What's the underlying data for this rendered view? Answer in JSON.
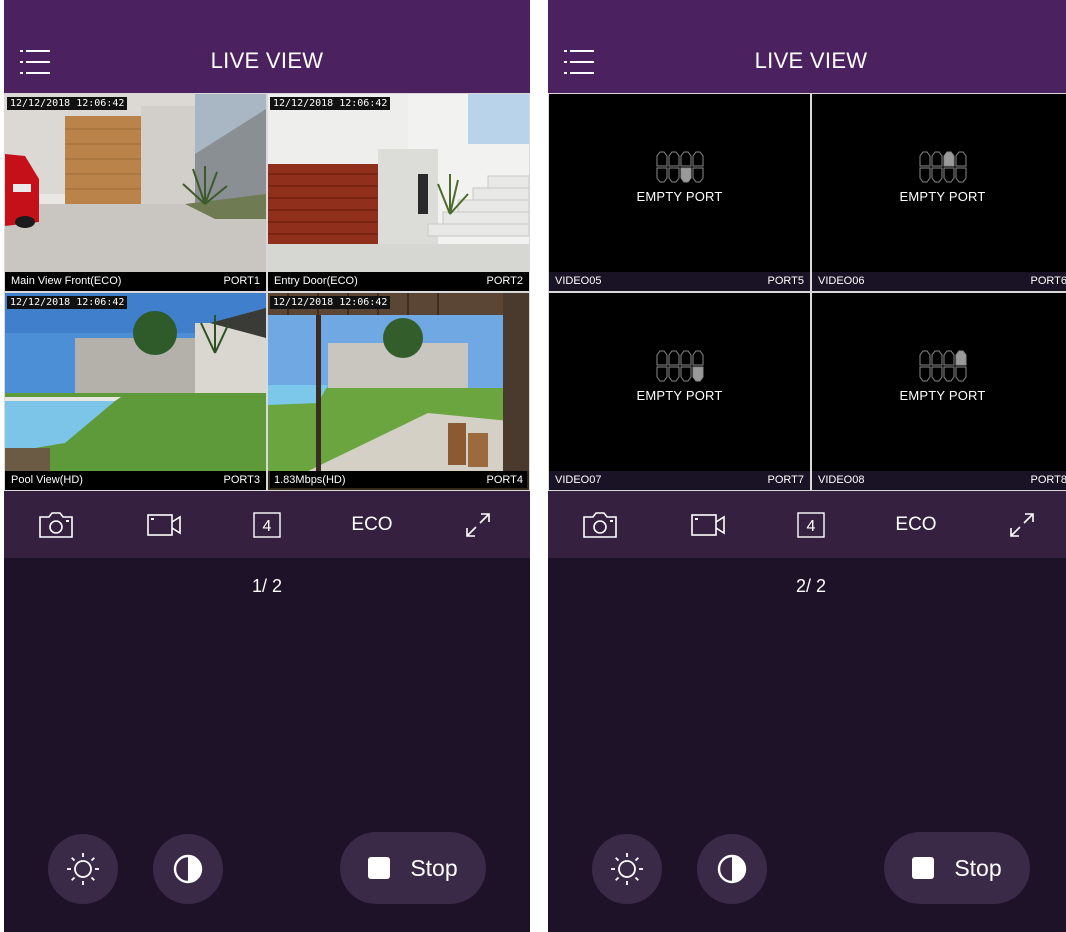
{
  "screens": [
    {
      "title": "LIVE VIEW",
      "page_indicator": "1/ 2",
      "toolbar": {
        "snapshot_icon": "camera-icon",
        "record_icon": "video-camera-icon",
        "layout_label": "4",
        "quality_label": "ECO",
        "fullscreen_icon": "expand-icon"
      },
      "controls": {
        "brightness_icon": "sun-icon",
        "contrast_icon": "contrast-icon",
        "stop_label": "Stop"
      },
      "cells": [
        {
          "timestamp": "12/12/2018 12:06:42",
          "name": "Main View Front(ECO)",
          "port": "PORT1"
        },
        {
          "timestamp": "12/12/2018 12:06:42",
          "name": "Entry Door(ECO)",
          "port": "PORT2"
        },
        {
          "timestamp": "12/12/2018 12:06:42",
          "name": "Pool View(HD)",
          "port": "PORT3"
        },
        {
          "timestamp": "12/12/2018 12:06:42",
          "name": "1.83Mbps(HD)",
          "port": "PORT4",
          "selected": true
        }
      ]
    },
    {
      "title": "LIVE VIEW",
      "page_indicator": "2/ 2",
      "toolbar": {
        "snapshot_icon": "camera-icon",
        "record_icon": "video-camera-icon",
        "layout_label": "4",
        "quality_label": "ECO",
        "fullscreen_icon": "expand-icon"
      },
      "controls": {
        "brightness_icon": "sun-icon",
        "contrast_icon": "contrast-icon",
        "stop_label": "Stop"
      },
      "cells": [
        {
          "status": "EMPTY PORT",
          "name": "VIDEO05",
          "port": "PORT5",
          "active_port_slot": 7
        },
        {
          "status": "EMPTY PORT",
          "name": "VIDEO06",
          "port": "PORT6",
          "active_port_slot": 3
        },
        {
          "status": "EMPTY PORT",
          "name": "VIDEO07",
          "port": "PORT7",
          "active_port_slot": 8
        },
        {
          "status": "EMPTY PORT",
          "name": "VIDEO08",
          "port": "PORT8",
          "active_port_slot": 4
        }
      ]
    }
  ],
  "colors": {
    "header": "#4b2160",
    "background": "#1e1228",
    "toolbar": "#35213f",
    "button": "#3a2a48",
    "selected_border": "#c9a85a"
  }
}
